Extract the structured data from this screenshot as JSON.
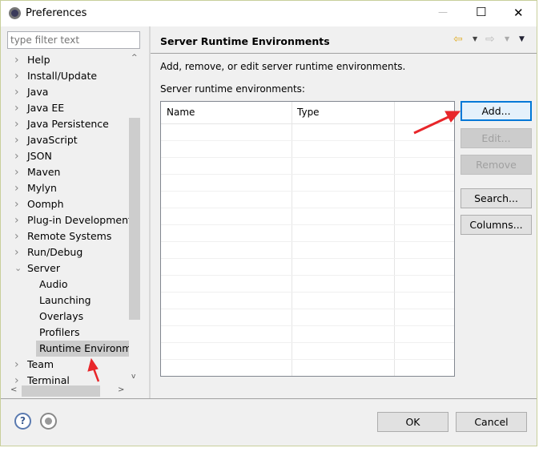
{
  "window": {
    "title": "Preferences",
    "minimize": "—",
    "maximize": "☐",
    "close": "✕"
  },
  "filter": {
    "placeholder": "type filter text"
  },
  "tree": {
    "items": [
      {
        "label": "Help",
        "level": 0
      },
      {
        "label": "Install/Update",
        "level": 0
      },
      {
        "label": "Java",
        "level": 0
      },
      {
        "label": "Java EE",
        "level": 0
      },
      {
        "label": "Java Persistence",
        "level": 0
      },
      {
        "label": "JavaScript",
        "level": 0
      },
      {
        "label": "JSON",
        "level": 0
      },
      {
        "label": "Maven",
        "level": 0
      },
      {
        "label": "Mylyn",
        "level": 0
      },
      {
        "label": "Oomph",
        "level": 0
      },
      {
        "label": "Plug-in Development",
        "level": 0
      },
      {
        "label": "Remote Systems",
        "level": 0
      },
      {
        "label": "Run/Debug",
        "level": 0
      },
      {
        "label": "Server",
        "level": 0,
        "expanded": true
      },
      {
        "label": "Audio",
        "level": 1
      },
      {
        "label": "Launching",
        "level": 1
      },
      {
        "label": "Overlays",
        "level": 1
      },
      {
        "label": "Profilers",
        "level": 1
      },
      {
        "label": "Runtime Environm",
        "level": 1,
        "selected": true
      },
      {
        "label": "Team",
        "level": 0
      },
      {
        "label": "Terminal",
        "level": 0
      }
    ]
  },
  "page": {
    "title": "Server Runtime Environments",
    "description": "Add, remove, or edit server runtime environments.",
    "list_label": "Server runtime environments:"
  },
  "table": {
    "columns": [
      "Name",
      "Type",
      ""
    ],
    "rows": []
  },
  "buttons": {
    "add": "Add...",
    "edit": "Edit...",
    "remove": "Remove",
    "search": "Search...",
    "columns": "Columns...",
    "ok": "OK",
    "cancel": "Cancel"
  },
  "colors": {
    "accent": "#0078d7",
    "annotation": "#e8262a",
    "selection": "#cccccc"
  }
}
